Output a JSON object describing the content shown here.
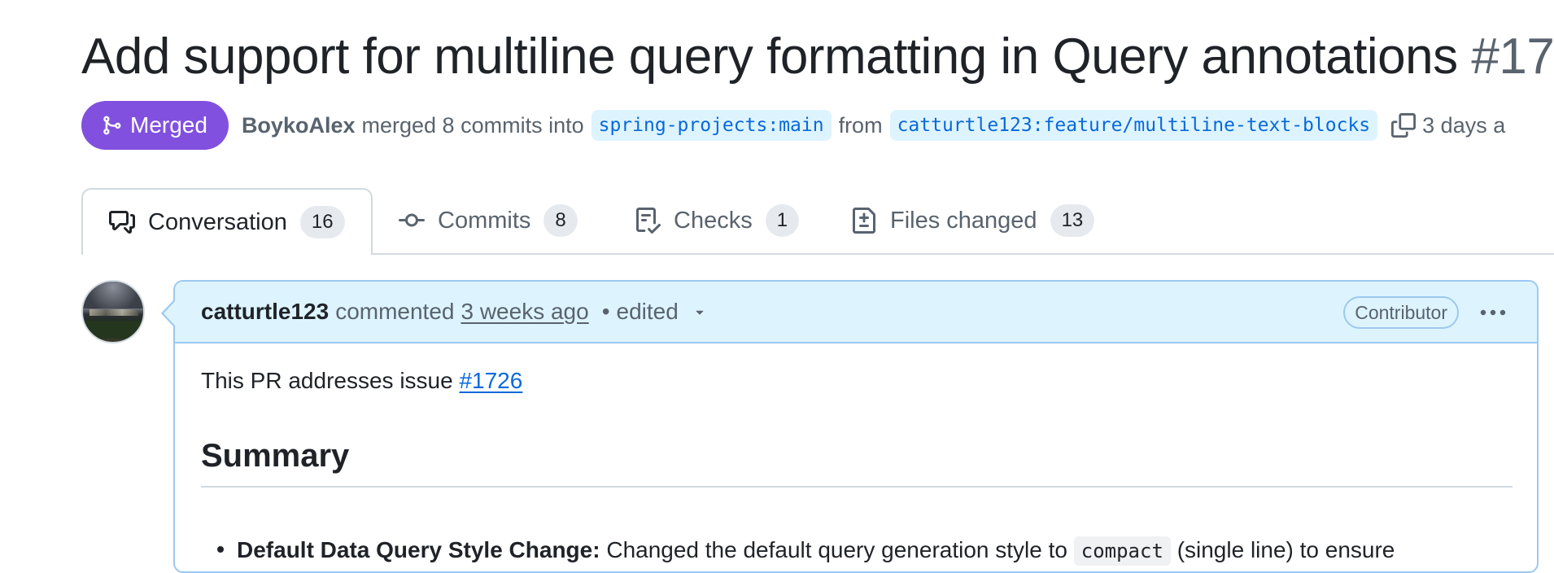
{
  "pr": {
    "title": "Add support for multiline query formatting in Query annotations",
    "number": "#17",
    "state": "Merged",
    "author": "BoykoAlex",
    "merge_text": "merged 8 commits into",
    "base_branch": "spring-projects:main",
    "from_text": "from",
    "head_branch": "catturtle123:feature/multiline-text-blocks",
    "time": "3 days a"
  },
  "tabs": [
    {
      "label": "Conversation",
      "count": "16",
      "icon": "comment-discussion-icon"
    },
    {
      "label": "Commits",
      "count": "8",
      "icon": "git-commit-icon"
    },
    {
      "label": "Checks",
      "count": "1",
      "icon": "checklist-icon"
    },
    {
      "label": "Files changed",
      "count": "13",
      "icon": "file-diff-icon"
    }
  ],
  "comment": {
    "author": "catturtle123",
    "action": "commented",
    "time": "3 weeks ago",
    "separator": "•",
    "edited": "edited",
    "role": "Contributor",
    "body_intro": "This PR addresses issue",
    "issue_link": "#1726",
    "summary_heading": "Summary",
    "bullet_bold": "Default Data Query Style Change:",
    "bullet_text_1": "Changed the default query generation style to",
    "bullet_code": "compact",
    "bullet_text_2": "(single line) to ensure"
  },
  "colors": {
    "merged": "#8250df",
    "link": "#0969da",
    "header_bg": "#ddf4ff",
    "border_accent": "#9cc8f0"
  }
}
